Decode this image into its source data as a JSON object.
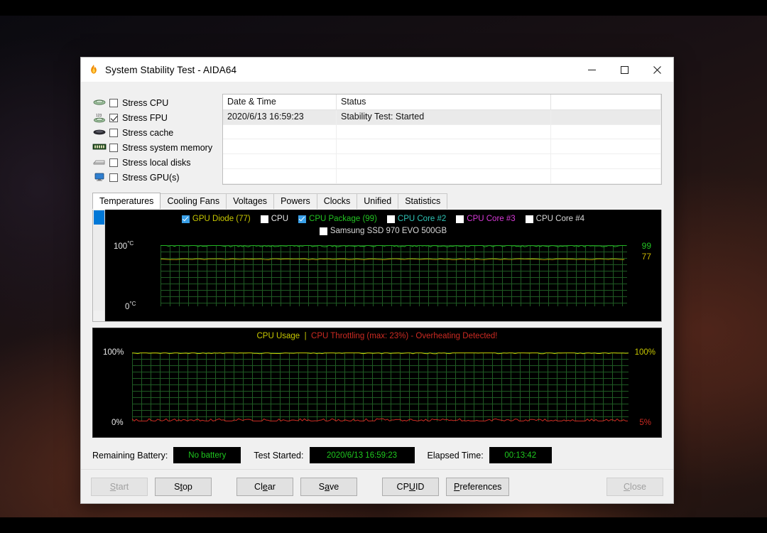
{
  "window": {
    "title": "System Stability Test - AIDA64",
    "icon": "flame-icon",
    "minimize": "—",
    "maximize": "□",
    "close": "✕"
  },
  "stress_options": [
    {
      "label": "Stress CPU",
      "checked": false,
      "icon": "cpu-chip-icon"
    },
    {
      "label": "Stress FPU",
      "checked": true,
      "icon": "fpu-chip-icon"
    },
    {
      "label": "Stress cache",
      "checked": false,
      "icon": "cache-chip-icon"
    },
    {
      "label": "Stress system memory",
      "checked": false,
      "icon": "memory-module-icon"
    },
    {
      "label": "Stress local disks",
      "checked": false,
      "icon": "hard-disk-icon"
    },
    {
      "label": "Stress GPU(s)",
      "checked": false,
      "icon": "gpu-monitor-icon"
    }
  ],
  "status_table": {
    "columns": [
      "Date & Time",
      "Status",
      ""
    ],
    "rows": [
      {
        "datetime": "2020/6/13 16:59:23",
        "status": "Stability Test: Started",
        "extra": ""
      }
    ],
    "empty_rows": 4
  },
  "tabs": [
    {
      "label": "Temperatures",
      "active": true
    },
    {
      "label": "Cooling Fans",
      "active": false
    },
    {
      "label": "Voltages",
      "active": false
    },
    {
      "label": "Powers",
      "active": false
    },
    {
      "label": "Clocks",
      "active": false
    },
    {
      "label": "Unified",
      "active": false
    },
    {
      "label": "Statistics",
      "active": false
    }
  ],
  "temperature_chart": {
    "legend_row1": [
      {
        "label": "GPU Diode (77)",
        "checked": true,
        "color": "#c8c800"
      },
      {
        "label": "CPU",
        "checked": false,
        "color": "#e8e8e8"
      },
      {
        "label": "CPU Package (99)",
        "checked": true,
        "color": "#22c322"
      },
      {
        "label": "CPU Core #2",
        "checked": false,
        "color": "#2ec4b6"
      },
      {
        "label": "CPU Core #3",
        "checked": false,
        "color": "#d93ad9"
      },
      {
        "label": "CPU Core #4",
        "checked": false,
        "color": "#d8d8d8"
      }
    ],
    "legend_row2": [
      {
        "label": "Samsung SSD 970 EVO 500GB",
        "checked": false,
        "color": "#d8d8d8"
      }
    ],
    "y_top": "100",
    "y_top_unit": "°C",
    "y_bottom": "0",
    "y_bottom_unit": "°C",
    "current_values": [
      {
        "value": "99",
        "color": "#22c322",
        "series": "CPU Package"
      },
      {
        "value": "77",
        "color": "#c8b400",
        "series": "GPU Diode"
      }
    ]
  },
  "chart_data": [
    {
      "type": "line",
      "title": "Temperatures",
      "ylabel": "°C",
      "ylim": [
        0,
        100
      ],
      "grid": true,
      "series": [
        {
          "name": "CPU Package",
          "color": "#22c322",
          "current": 99,
          "approx_level_pct": 99
        },
        {
          "name": "GPU Diode",
          "color": "#c8b400",
          "current": 77,
          "approx_level_pct": 77
        }
      ],
      "legend": [
        "GPU Diode (77)",
        "CPU",
        "CPU Package (99)",
        "CPU Core #2",
        "CPU Core #3",
        "CPU Core #4",
        "Samsung SSD 970 EVO 500GB"
      ]
    },
    {
      "type": "line",
      "title": "CPU Usage  |  CPU Throttling (max: 23%) - Overheating Detected!",
      "ylabel": "%",
      "ylim": [
        0,
        100
      ],
      "grid": true,
      "series": [
        {
          "name": "CPU Usage",
          "color": "#c8c800",
          "current": 100,
          "approx_level_pct": 100
        },
        {
          "name": "CPU Throttling",
          "color": "#cc2a22",
          "current": 5,
          "max": 23
        }
      ]
    }
  ],
  "usage_chart": {
    "title_main": "CPU Usage",
    "title_sep": "|",
    "title_alert": "CPU Throttling (max: 23%) - Overheating Detected!",
    "y_top": "100%",
    "y_bottom": "0%",
    "r_top": "100%",
    "r_bottom": "5%"
  },
  "footer": {
    "battery_label": "Remaining Battery:",
    "battery_value": "No battery",
    "started_label": "Test Started:",
    "started_value": "2020/6/13 16:59:23",
    "elapsed_label": "Elapsed Time:",
    "elapsed_value": "00:13:42"
  },
  "buttons": [
    {
      "label": "Start",
      "disabled": true,
      "accel": "S"
    },
    {
      "label": "Stop",
      "disabled": false,
      "accel": "t"
    },
    {
      "label": "Clear",
      "disabled": false,
      "accel": "e"
    },
    {
      "label": "Save",
      "disabled": false,
      "accel": "a"
    },
    {
      "label": "CPUID",
      "disabled": false,
      "accel": "U"
    },
    {
      "label": "Preferences",
      "disabled": false,
      "accel": "P"
    },
    {
      "label": "Close",
      "disabled": true,
      "accel": "C"
    }
  ]
}
